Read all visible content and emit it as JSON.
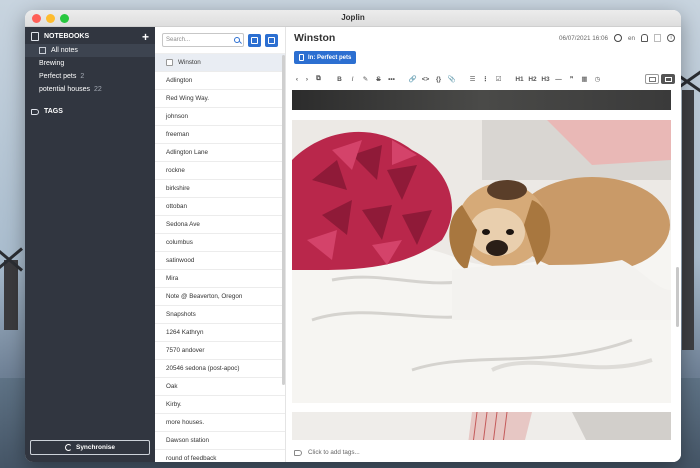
{
  "window": {
    "title": "Joplin"
  },
  "sidebar": {
    "notebooks_label": "NOTEBOOKS",
    "add_label": "+",
    "all_notes_label": "All notes",
    "notebooks": [
      {
        "name": "Brewing",
        "count": ""
      },
      {
        "name": "Perfect pets",
        "count": "2"
      },
      {
        "name": "potential houses",
        "count": "22"
      }
    ],
    "tags_label": "TAGS",
    "sync_label": "Synchronise"
  },
  "note_list": {
    "search_placeholder": "Search...",
    "notes": [
      "Winston",
      "Adlington",
      "Red Wing Way.",
      "johnson",
      "freeman",
      "Adlington Lane",
      "rockne",
      "birkshire",
      "ottoban",
      "Sedona Ave",
      "columbus",
      "satinwood",
      "Mira",
      "Note @ Beaverton, Oregon",
      "Snapshots",
      "1264 Kathryn",
      "7570 andover",
      "20546 sedona (post-apoc)",
      "Oak",
      "Kirby.",
      "more houses.",
      "Dawson station",
      "round of feedback"
    ]
  },
  "editor": {
    "title": "Winston",
    "datetime": "06/07/2021 16:06",
    "language": "en",
    "notebook_badge": "In: Perfect pets",
    "toolbar": {
      "back": "‹",
      "forward": "›",
      "external": "⧉",
      "bold": "B",
      "italic": "I",
      "highlight": "✎",
      "strike": "S",
      "more": "•••",
      "link": "🔗",
      "code": "<>",
      "code_block": "{}",
      "attach": "📎",
      "bullet": "☰",
      "numbered": "⋮",
      "checklist": "☑",
      "h1": "H1",
      "h2": "H2",
      "h3": "H3",
      "hr": "—",
      "quote": "❞",
      "table": "▦",
      "time": "◷"
    },
    "footer_tags_placeholder": "Click to add tags..."
  },
  "colors": {
    "accent": "#2c6fd1",
    "sidebar_bg": "#313640"
  }
}
